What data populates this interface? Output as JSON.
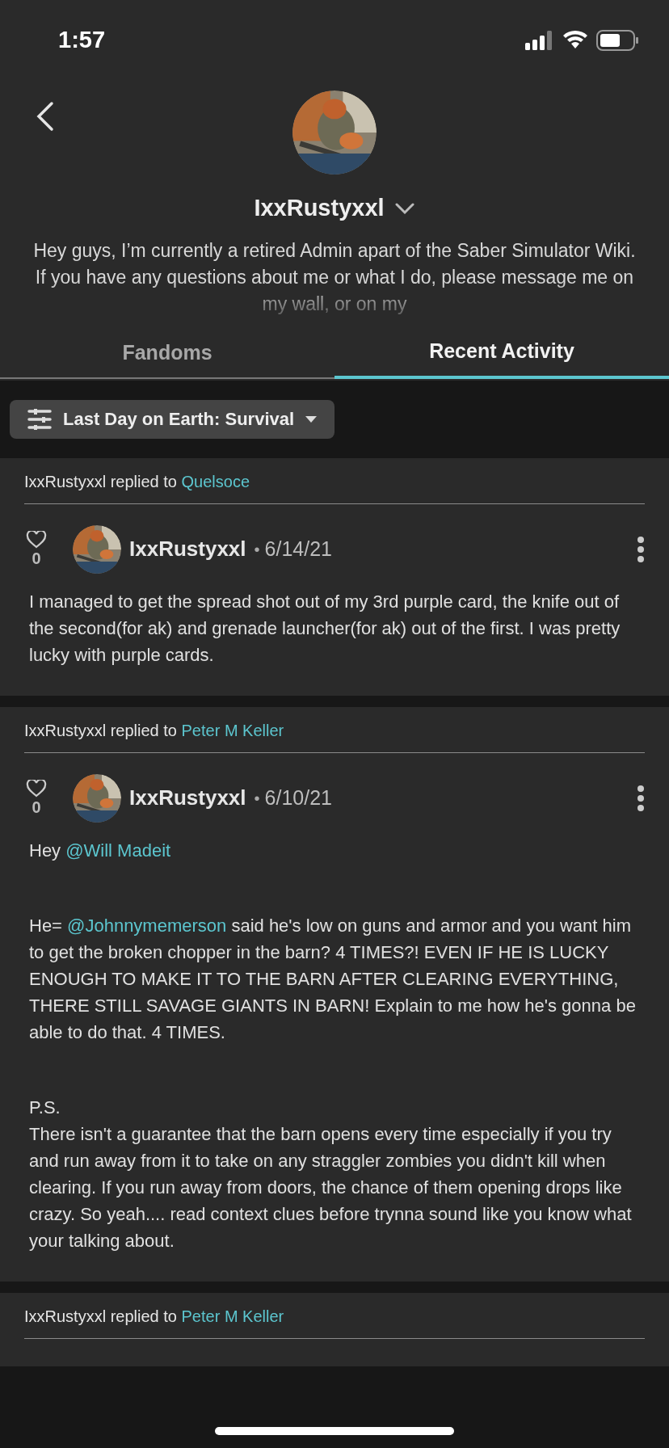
{
  "status_bar": {
    "time": "1:57"
  },
  "profile": {
    "username": "IxxRustyxxl",
    "bio": "Hey guys, I’m currently a retired Admin apart of the Saber Simulator Wiki. If you have any questions about me or what I do, please message me on my wall, or on my"
  },
  "tabs": [
    {
      "label": "Fandoms",
      "selected": false
    },
    {
      "label": "Recent Activity",
      "selected": true
    }
  ],
  "filter": {
    "label": "Last Day on Earth: Survival"
  },
  "activity": [
    {
      "author": "IxxRustyxxl",
      "action": "replied to",
      "target": "Quelsoce",
      "post": {
        "likes": "0",
        "user": "IxxRustyxxl",
        "separator": "•",
        "date": "6/14/21",
        "paragraphs": [
          [
            {
              "text": "I managed to get the spread shot out of my 3rd purple card, the knife out of the second(for ak) and grenade launcher(for ak) out of the first. I was pretty lucky with purple cards."
            }
          ]
        ]
      }
    },
    {
      "author": "IxxRustyxxl",
      "action": "replied to",
      "target": "Peter M Keller",
      "post": {
        "likes": "0",
        "user": "IxxRustyxxl",
        "separator": "•",
        "date": "6/10/21",
        "paragraphs": [
          [
            {
              "text": "Hey "
            },
            {
              "text": "@Will Madeit",
              "kind": "mention"
            }
          ],
          [
            {
              "text": "He= "
            },
            {
              "text": "@Johnnymemerson",
              "kind": "mention"
            },
            {
              "text": " said he's low on guns and armor and you want him to get the broken chopper in the barn? 4 TIMES?! EVEN IF HE IS LUCKY ENOUGH TO MAKE IT TO THE BARN AFTER CLEARING EVERYTHING, THERE STILL SAVAGE GIANTS IN BARN! Explain to me how he's gonna be able to do that. 4 TIMES."
            }
          ],
          [
            {
              "text": "P.S."
            }
          ],
          [
            {
              "text": "There isn't a guarantee that the barn opens every time especially if you try and run away from it to take on any straggler zombies you didn't kill when clearing. If you run away from doors, the chance of them opening drops like crazy. So yeah.... read context clues before trynna sound like you know what your talking about."
            }
          ]
        ]
      }
    },
    {
      "author": "IxxRustyxxl",
      "action": "replied to",
      "target": "Peter M Keller"
    }
  ]
}
